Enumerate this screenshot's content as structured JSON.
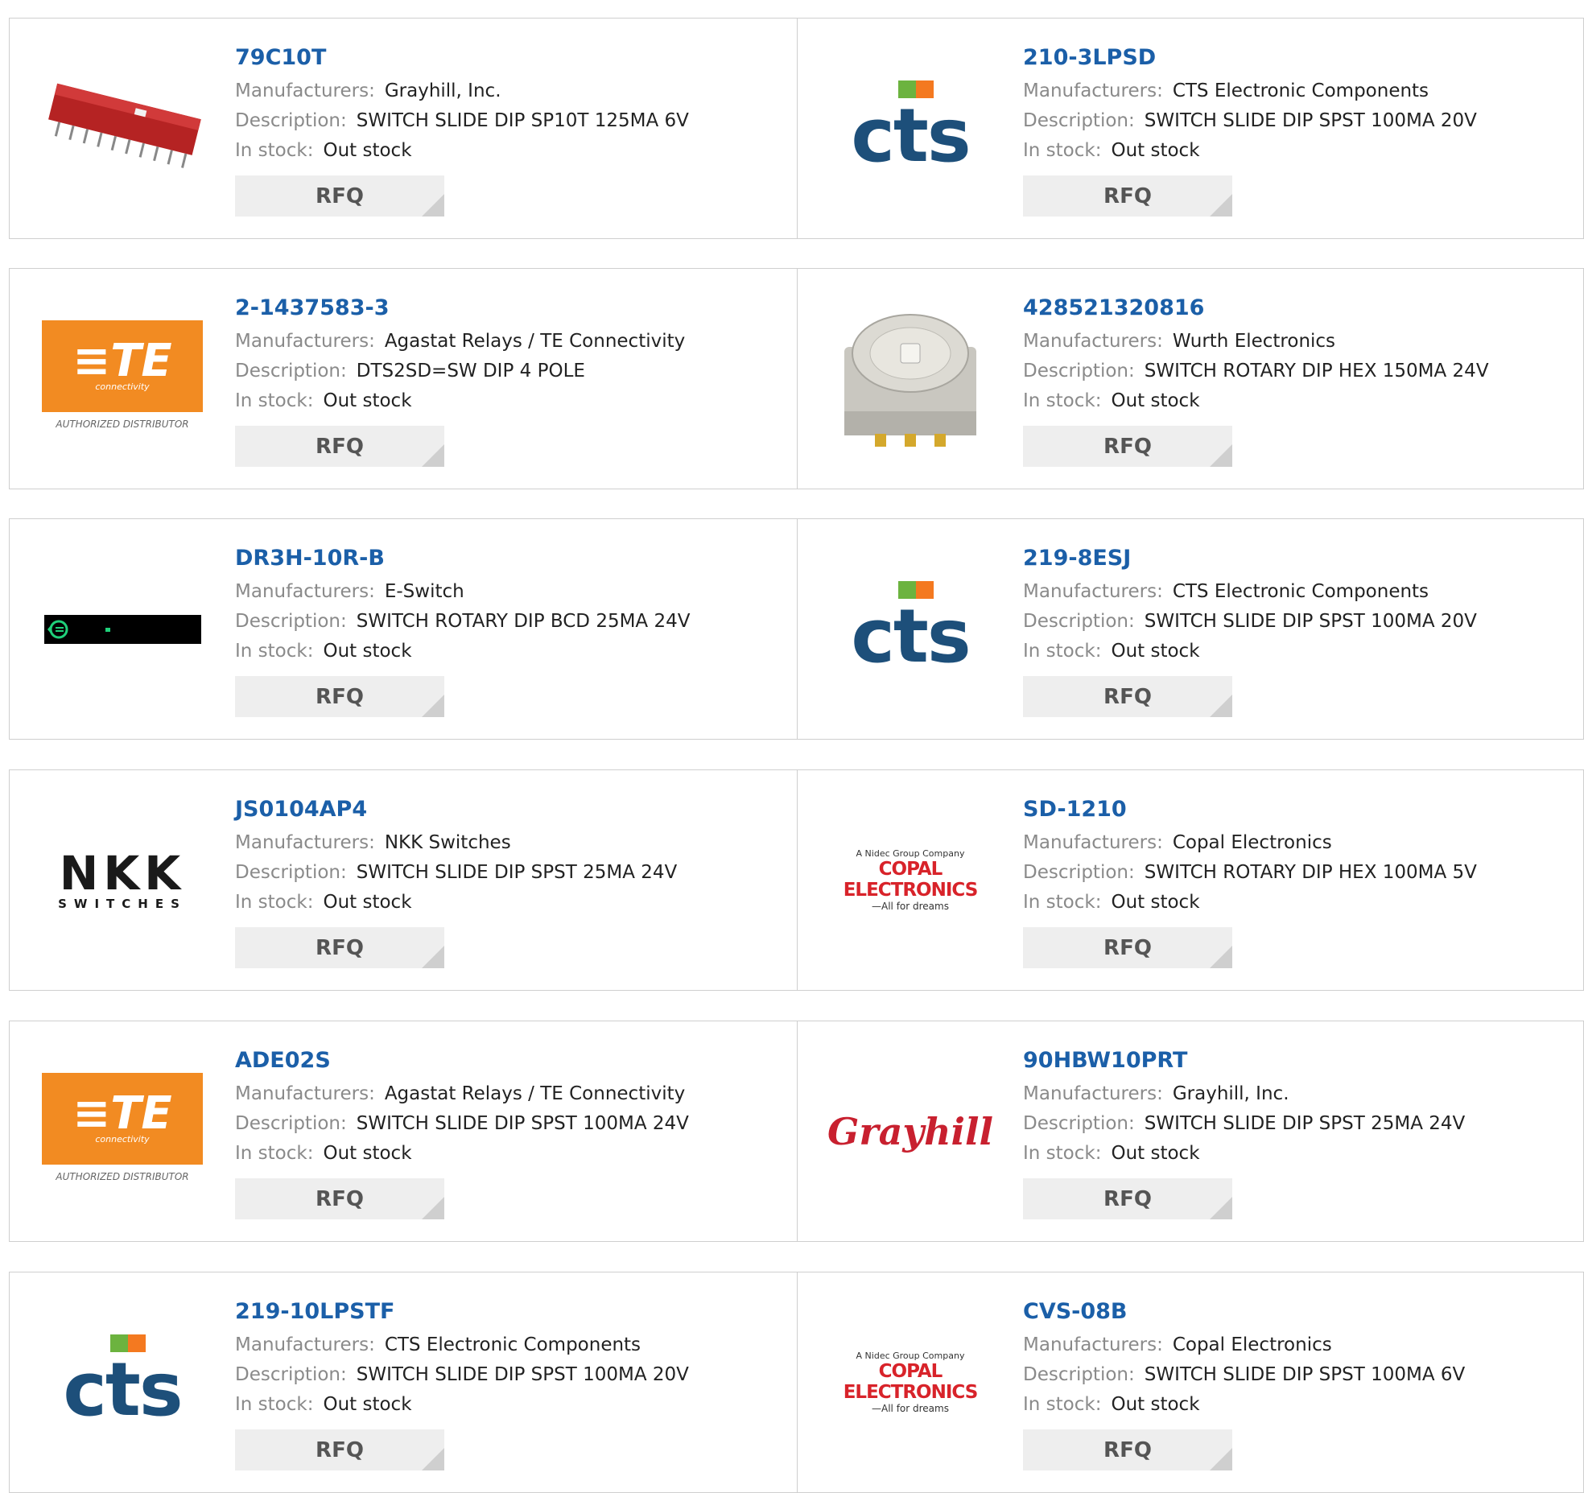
{
  "colors": {
    "part_number": "#1b5fa8",
    "label_gray": "#8a8a8a",
    "value_text": "#222222",
    "button_bg": "#eeeeee",
    "border": "#cfcfcf",
    "cts_blue": "#1d4f7a",
    "cts_green": "#6cb33f",
    "cts_orange": "#f47920",
    "te_orange": "#f28b22",
    "grayhill_red": "#c8202f",
    "copal_red": "#d8232a",
    "nkk_black": "#1a1a1a"
  },
  "labels": {
    "manufacturers": "Manufacturers:",
    "description": "Description:",
    "in_stock": "In stock:",
    "rfq": "RFQ"
  },
  "logo_text": {
    "cts": "cts",
    "te_mark": "≡TE",
    "te_sub": "connectivity",
    "te_auth": "AUTHORIZED DISTRIBUTOR",
    "nkk_big": "NKK",
    "nkk_small": "SWITCHES",
    "copal_top": "A Nidec Group Company",
    "copal_mid": "COPAL ELECTRONICS",
    "copal_bot": "—All for dreams",
    "grayhill": "Grayhill"
  },
  "products": [
    {
      "part": "79C10T",
      "manufacturer": "Grayhill, Inc.",
      "description": "SWITCH SLIDE DIP SP10T 125MA 6V",
      "stock": "Out stock",
      "image": "red-dip-switch-photo"
    },
    {
      "part": "210-3LPSD",
      "manufacturer": "CTS Electronic Components",
      "description": "SWITCH SLIDE DIP SPST 100MA 20V",
      "stock": "Out stock",
      "image": "cts-logo"
    },
    {
      "part": "2-1437583-3",
      "manufacturer": "Agastat Relays / TE Connectivity",
      "description": "DTS2SD=SW DIP 4 POLE",
      "stock": "Out stock",
      "image": "te-connectivity-logo"
    },
    {
      "part": "428521320816",
      "manufacturer": "Wurth Electronics",
      "description": "SWITCH ROTARY DIP HEX 150MA 24V",
      "stock": "Out stock",
      "image": "rotary-dip-switch-photo"
    },
    {
      "part": "DR3H-10R-B",
      "manufacturer": "E-Switch",
      "description": "SWITCH ROTARY DIP BCD 25MA 24V",
      "stock": "Out stock",
      "image": "e-switch-logo"
    },
    {
      "part": "219-8ESJ",
      "manufacturer": "CTS Electronic Components",
      "description": "SWITCH SLIDE DIP SPST 100MA 20V",
      "stock": "Out stock",
      "image": "cts-logo"
    },
    {
      "part": "JS0104AP4",
      "manufacturer": "NKK Switches",
      "description": "SWITCH SLIDE DIP SPST 25MA 24V",
      "stock": "Out stock",
      "image": "nkk-switches-logo"
    },
    {
      "part": "SD-1210",
      "manufacturer": "Copal Electronics",
      "description": "SWITCH ROTARY DIP HEX 100MA 5V",
      "stock": "Out stock",
      "image": "copal-electronics-logo"
    },
    {
      "part": "ADE02S",
      "manufacturer": "Agastat Relays / TE Connectivity",
      "description": "SWITCH SLIDE DIP SPST 100MA 24V",
      "stock": "Out stock",
      "image": "te-connectivity-logo"
    },
    {
      "part": "90HBW10PRT",
      "manufacturer": "Grayhill, Inc.",
      "description": "SWITCH SLIDE DIP SPST 25MA 24V",
      "stock": "Out stock",
      "image": "grayhill-logo"
    },
    {
      "part": "219-10LPSTF",
      "manufacturer": "CTS Electronic Components",
      "description": "SWITCH SLIDE DIP SPST 100MA 20V",
      "stock": "Out stock",
      "image": "cts-logo"
    },
    {
      "part": "CVS-08B",
      "manufacturer": "Copal Electronics",
      "description": "SWITCH SLIDE DIP SPST 100MA 6V",
      "stock": "Out stock",
      "image": "copal-electronics-logo"
    }
  ]
}
